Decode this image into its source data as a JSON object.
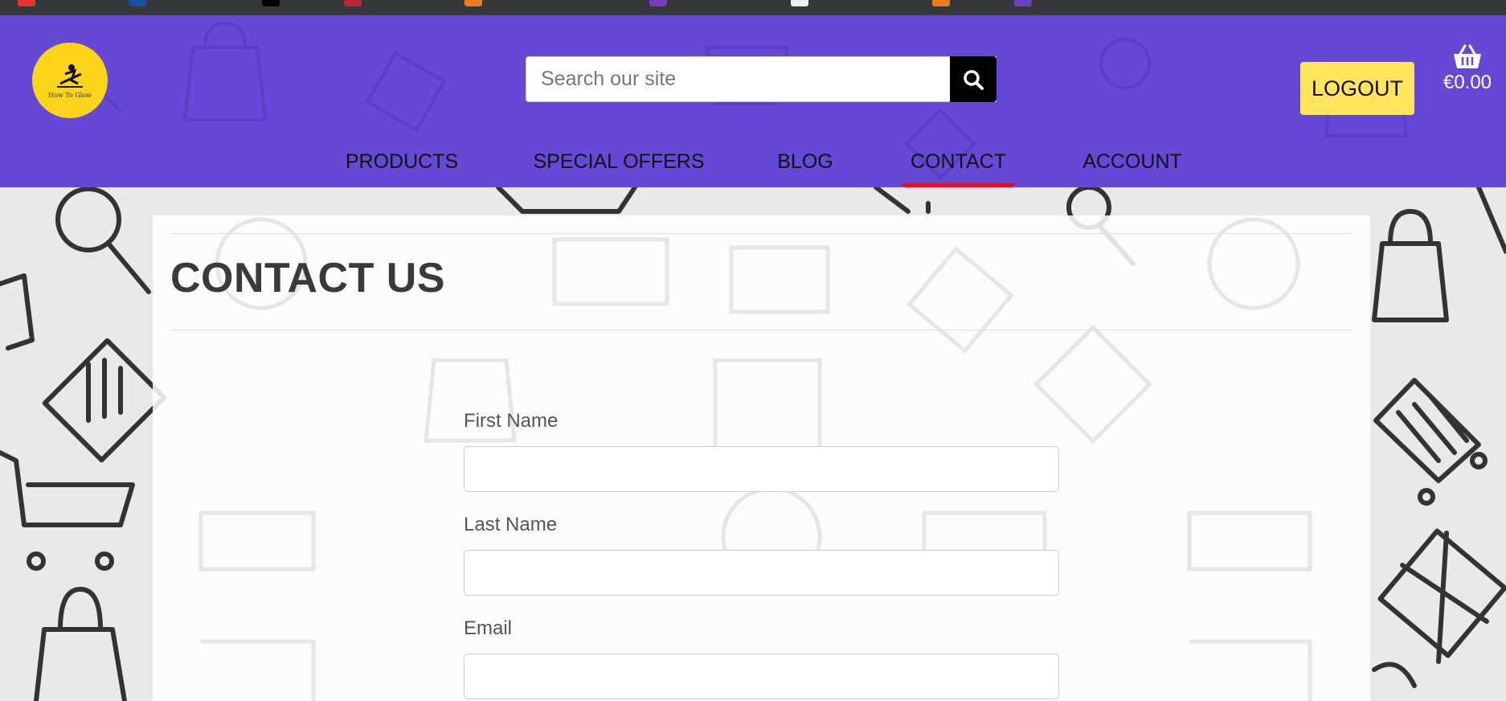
{
  "header": {
    "logo_text": "How To Glow",
    "search": {
      "placeholder": "Search our site",
      "button_icon": "search-icon"
    },
    "logout_label": "LOGOUT",
    "cart": {
      "icon": "basket-icon",
      "total": "€0.00"
    }
  },
  "nav": {
    "items": [
      {
        "label": "PRODUCTS"
      },
      {
        "label": "SPECIAL OFFERS"
      },
      {
        "label": "BLOG"
      },
      {
        "label": "CONTACT",
        "active": true
      },
      {
        "label": "ACCOUNT"
      }
    ]
  },
  "main": {
    "title": "CONTACT US",
    "form": {
      "fields": [
        {
          "label": "First Name",
          "value": ""
        },
        {
          "label": "Last Name",
          "value": ""
        },
        {
          "label": "Email",
          "value": ""
        }
      ]
    }
  },
  "colors": {
    "header_bg": "#6548d6",
    "logo_bg": "#fcd419",
    "logout_bg": "#ffe45c",
    "active_underline": "#e0101f",
    "search_button_bg": "#000000"
  }
}
